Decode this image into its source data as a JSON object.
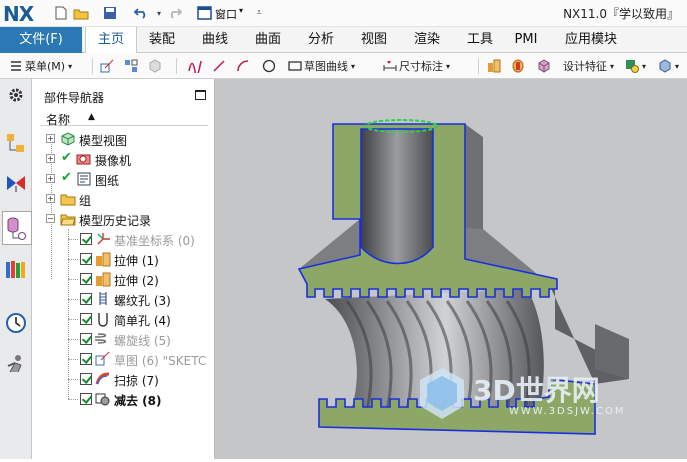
{
  "titlebar": {
    "logo": "NX",
    "window_menu": "窗口",
    "title": "NX11.0『学以致用』"
  },
  "menu": {
    "file": "文件(F)",
    "tabs": [
      "主页",
      "装配",
      "曲线",
      "曲面",
      "分析",
      "视图",
      "渲染",
      "工具",
      "PMI",
      "应用模块"
    ],
    "active_tab": "主页"
  },
  "toolbar": {
    "menu_label": "菜单(M)",
    "sketch_curve": "草图曲线",
    "dimension": "尺寸标注",
    "design_feature": "设计特征"
  },
  "navigator": {
    "title": "部件导航器",
    "column_header": "名称",
    "items": [
      {
        "label": "模型视图",
        "state": "none"
      },
      {
        "label": "摄像机",
        "state": "check"
      },
      {
        "label": "图纸",
        "state": "check"
      },
      {
        "label": "组",
        "state": "none"
      },
      {
        "label": "模型历史记录",
        "state": "none"
      },
      {
        "label": "基准坐标系 (0)",
        "state": "dim"
      },
      {
        "label": "拉伸 (1)",
        "state": "normal"
      },
      {
        "label": "拉伸 (2)",
        "state": "normal"
      },
      {
        "label": "螺纹孔 (3)",
        "state": "normal"
      },
      {
        "label": "简单孔 (4)",
        "state": "normal"
      },
      {
        "label": "螺旋线 (5)",
        "state": "dim"
      },
      {
        "label": "草图 (6) \"SKETC",
        "state": "dim"
      },
      {
        "label": "扫掠 (7)",
        "state": "normal"
      },
      {
        "label": "减去 (8)",
        "state": "bold"
      }
    ]
  },
  "watermark": {
    "brand": "3D世界网",
    "url": "WWW.3DSJW.COM"
  },
  "colors": {
    "accent": "#2a79b4",
    "section_face": "#8faa6a",
    "edge": "#1a2fe0",
    "body": "#6b6d70",
    "viewport_bg": "#c4c6c8"
  }
}
